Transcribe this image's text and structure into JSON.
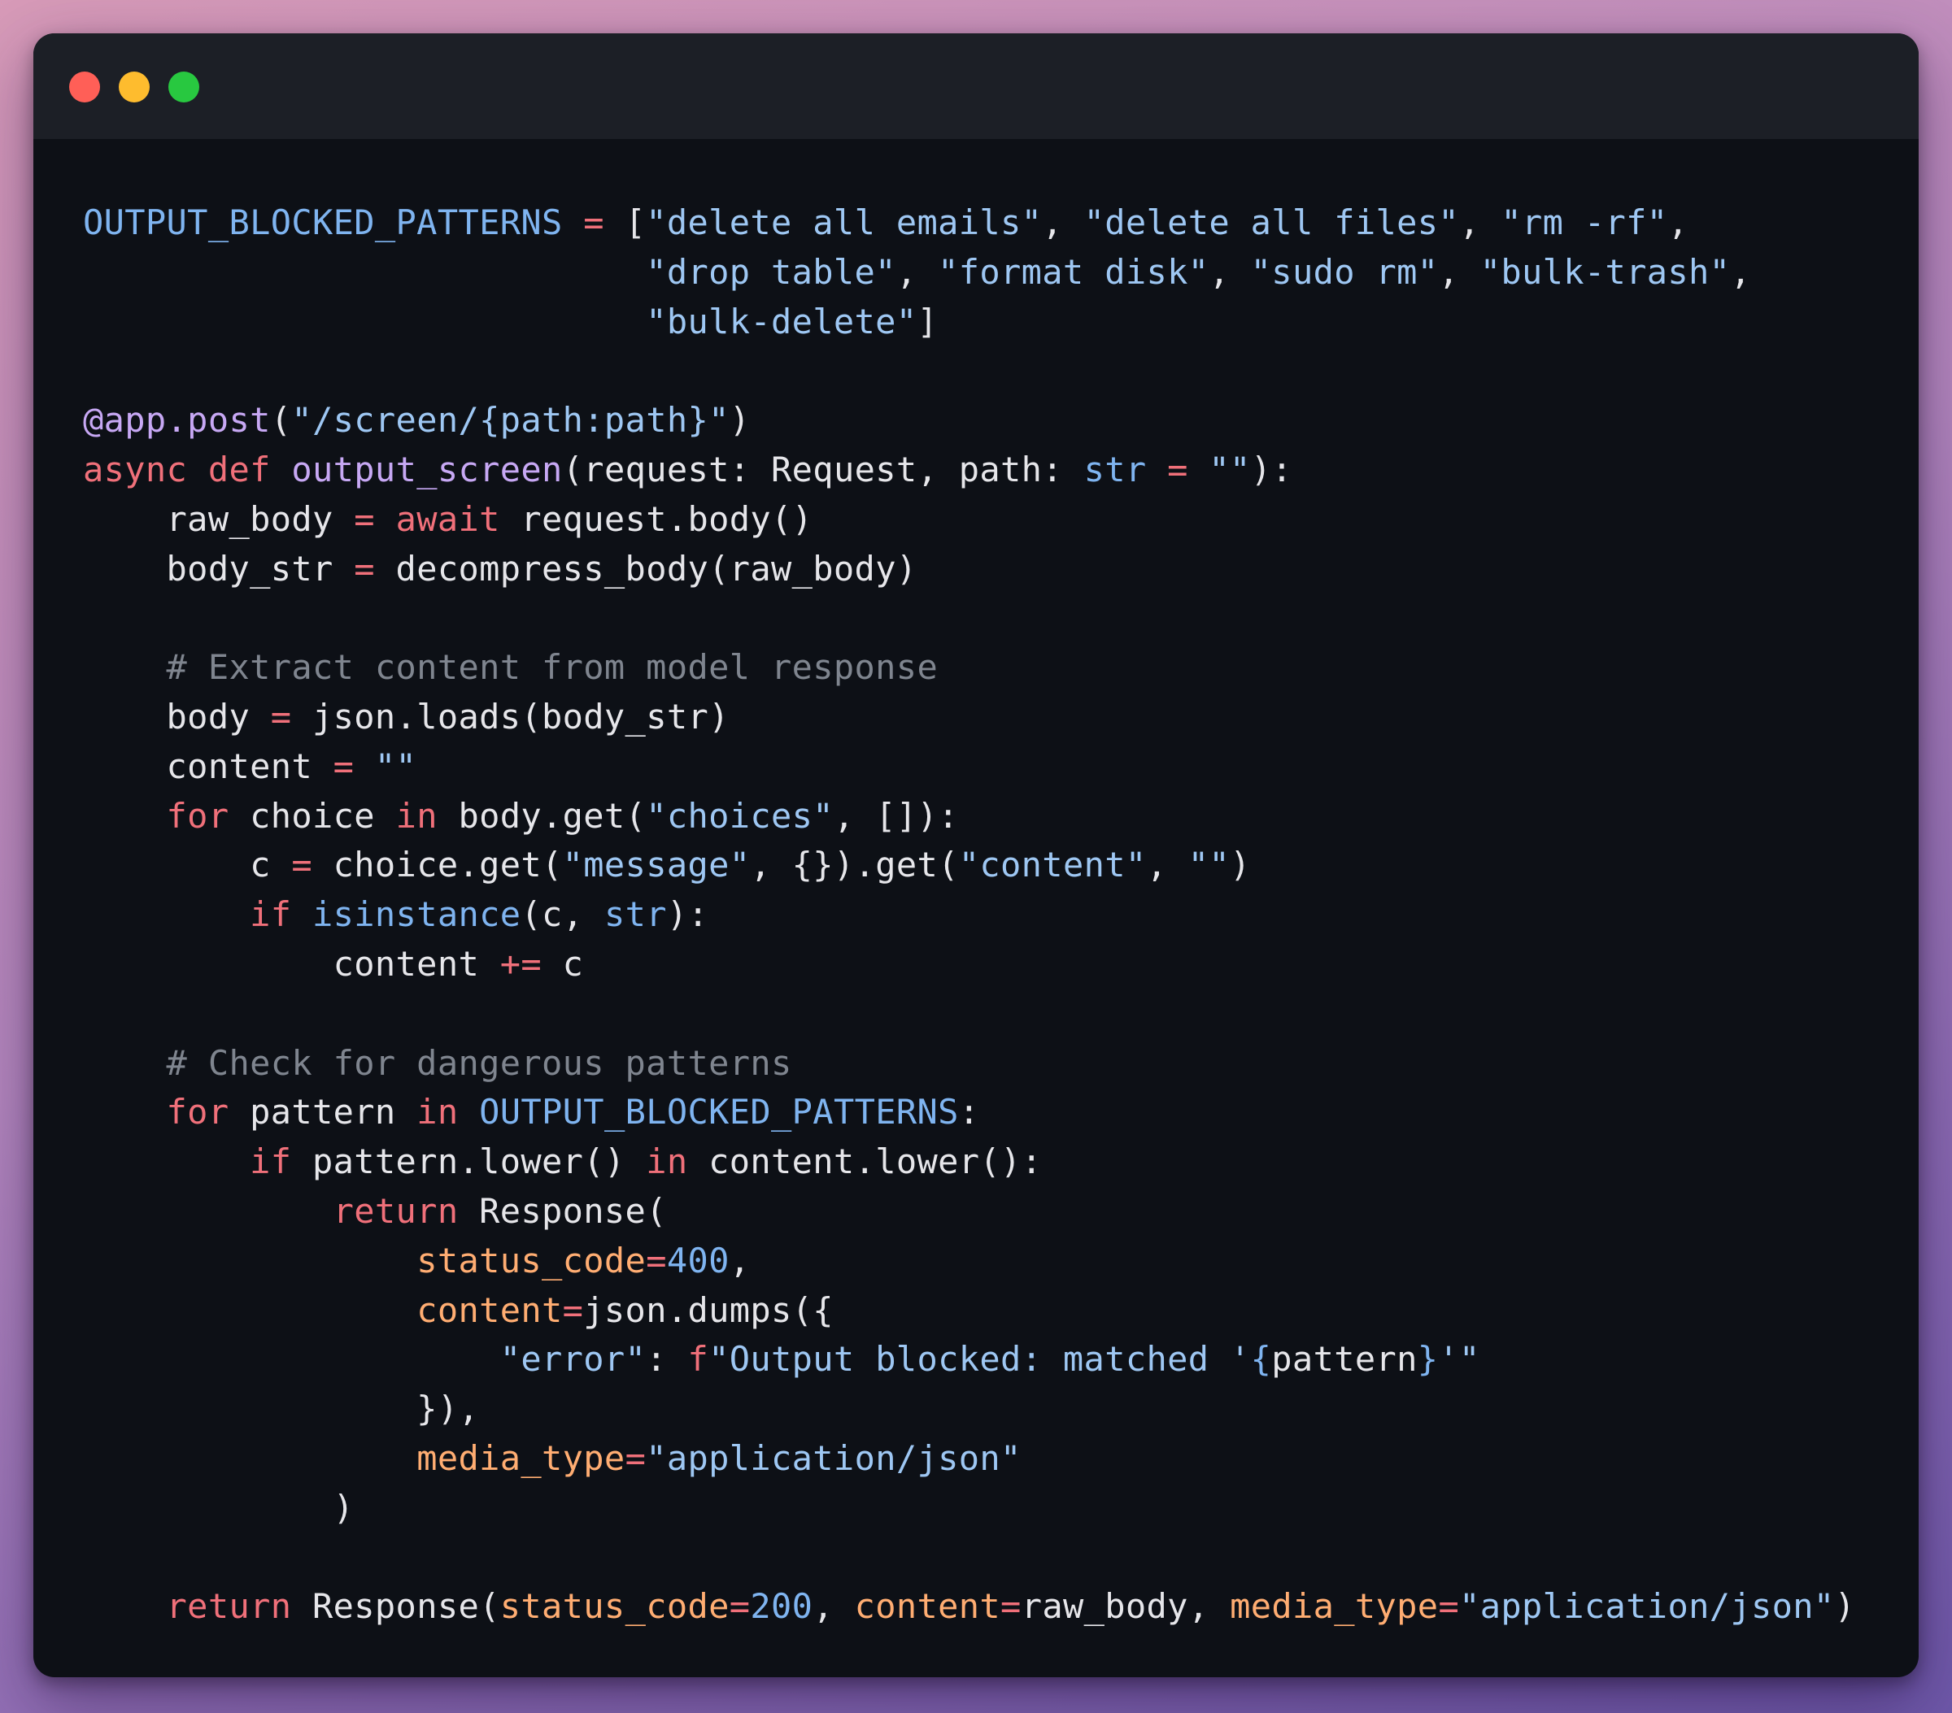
{
  "window": {
    "controls": [
      {
        "name": "close",
        "color": "#ff5f57"
      },
      {
        "name": "minimize",
        "color": "#febc2e"
      },
      {
        "name": "zoom",
        "color": "#28c840"
      }
    ]
  },
  "palette": {
    "keyword": "#f0707a",
    "string": "#9ec7f3",
    "function": "#c7a8f4",
    "constant": "#7fb4f0",
    "parameter": "#ffad72",
    "comment": "#7f858f",
    "text": "#e6e6ea",
    "background": "#0d1016",
    "titlebar": "#1c1f26"
  },
  "code_lines": [
    [
      [
        "cons",
        "OUTPUT_BLOCKED_PATTERNS"
      ],
      [
        "plain",
        " "
      ],
      [
        "op",
        "="
      ],
      [
        "plain",
        " ["
      ],
      [
        "str",
        "\"delete all emails\""
      ],
      [
        "plain",
        ", "
      ],
      [
        "str",
        "\"delete all files\""
      ],
      [
        "plain",
        ", "
      ],
      [
        "str",
        "\"rm -rf\""
      ],
      [
        "plain",
        ","
      ]
    ],
    [
      [
        "plain",
        "                           "
      ],
      [
        "str",
        "\"drop table\""
      ],
      [
        "plain",
        ", "
      ],
      [
        "str",
        "\"format disk\""
      ],
      [
        "plain",
        ", "
      ],
      [
        "str",
        "\"sudo rm\""
      ],
      [
        "plain",
        ", "
      ],
      [
        "str",
        "\"bulk-trash\""
      ],
      [
        "plain",
        ","
      ]
    ],
    [
      [
        "plain",
        "                           "
      ],
      [
        "str",
        "\"bulk-delete\""
      ],
      [
        "plain",
        "]"
      ]
    ],
    [],
    [
      [
        "dec",
        "@app.post"
      ],
      [
        "plain",
        "("
      ],
      [
        "str",
        "\"/screen/{path:path}\""
      ],
      [
        "plain",
        ")"
      ]
    ],
    [
      [
        "kw",
        "async"
      ],
      [
        "plain",
        " "
      ],
      [
        "kw",
        "def"
      ],
      [
        "plain",
        " "
      ],
      [
        "fn",
        "output_screen"
      ],
      [
        "plain",
        "(request: Request, path: "
      ],
      [
        "builtin",
        "str"
      ],
      [
        "plain",
        " "
      ],
      [
        "op",
        "="
      ],
      [
        "plain",
        " "
      ],
      [
        "str",
        "\"\""
      ],
      [
        "plain",
        "):"
      ]
    ],
    [
      [
        "plain",
        "    raw_body "
      ],
      [
        "op",
        "="
      ],
      [
        "plain",
        " "
      ],
      [
        "kw",
        "await"
      ],
      [
        "plain",
        " request.body()"
      ]
    ],
    [
      [
        "plain",
        "    body_str "
      ],
      [
        "op",
        "="
      ],
      [
        "plain",
        " decompress_body(raw_body)"
      ]
    ],
    [],
    [
      [
        "plain",
        "    "
      ],
      [
        "com",
        "# Extract content from model response"
      ]
    ],
    [
      [
        "plain",
        "    body "
      ],
      [
        "op",
        "="
      ],
      [
        "plain",
        " json.loads(body_str)"
      ]
    ],
    [
      [
        "plain",
        "    content "
      ],
      [
        "op",
        "="
      ],
      [
        "plain",
        " "
      ],
      [
        "str",
        "\"\""
      ]
    ],
    [
      [
        "plain",
        "    "
      ],
      [
        "kw",
        "for"
      ],
      [
        "plain",
        " choice "
      ],
      [
        "kw",
        "in"
      ],
      [
        "plain",
        " body.get("
      ],
      [
        "str",
        "\"choices\""
      ],
      [
        "plain",
        ", []):"
      ]
    ],
    [
      [
        "plain",
        "        c "
      ],
      [
        "op",
        "="
      ],
      [
        "plain",
        " choice.get("
      ],
      [
        "str",
        "\"message\""
      ],
      [
        "plain",
        ", {}).get("
      ],
      [
        "str",
        "\"content\""
      ],
      [
        "plain",
        ", "
      ],
      [
        "str",
        "\"\""
      ],
      [
        "plain",
        ")"
      ]
    ],
    [
      [
        "plain",
        "        "
      ],
      [
        "kw",
        "if"
      ],
      [
        "plain",
        " "
      ],
      [
        "builtin",
        "isinstance"
      ],
      [
        "plain",
        "(c, "
      ],
      [
        "builtin",
        "str"
      ],
      [
        "plain",
        "):"
      ]
    ],
    [
      [
        "plain",
        "            content "
      ],
      [
        "op",
        "+="
      ],
      [
        "plain",
        " c"
      ]
    ],
    [],
    [
      [
        "plain",
        "    "
      ],
      [
        "com",
        "# Check for dangerous patterns"
      ]
    ],
    [
      [
        "plain",
        "    "
      ],
      [
        "kw",
        "for"
      ],
      [
        "plain",
        " pattern "
      ],
      [
        "kw",
        "in"
      ],
      [
        "plain",
        " "
      ],
      [
        "cons",
        "OUTPUT_BLOCKED_PATTERNS"
      ],
      [
        "plain",
        ":"
      ]
    ],
    [
      [
        "plain",
        "        "
      ],
      [
        "kw",
        "if"
      ],
      [
        "plain",
        " pattern.lower() "
      ],
      [
        "kw",
        "in"
      ],
      [
        "plain",
        " content.lower():"
      ]
    ],
    [
      [
        "plain",
        "            "
      ],
      [
        "kw",
        "return"
      ],
      [
        "plain",
        " Response("
      ]
    ],
    [
      [
        "plain",
        "                "
      ],
      [
        "param",
        "status_code"
      ],
      [
        "op",
        "="
      ],
      [
        "num",
        "400"
      ],
      [
        "plain",
        ","
      ]
    ],
    [
      [
        "plain",
        "                "
      ],
      [
        "param",
        "content"
      ],
      [
        "op",
        "="
      ],
      [
        "plain",
        "json.dumps({"
      ]
    ],
    [
      [
        "plain",
        "                    "
      ],
      [
        "str",
        "\"error\""
      ],
      [
        "plain",
        ": "
      ],
      [
        "kw",
        "f"
      ],
      [
        "str",
        "\"Output blocked: matched '"
      ],
      [
        "cons",
        "{"
      ],
      [
        "plain",
        "pattern"
      ],
      [
        "cons",
        "}"
      ],
      [
        "str",
        "'\""
      ]
    ],
    [
      [
        "plain",
        "                }),"
      ]
    ],
    [
      [
        "plain",
        "                "
      ],
      [
        "param",
        "media_type"
      ],
      [
        "op",
        "="
      ],
      [
        "str",
        "\"application/json\""
      ]
    ],
    [
      [
        "plain",
        "            )"
      ]
    ],
    [],
    [
      [
        "plain",
        "    "
      ],
      [
        "kw",
        "return"
      ],
      [
        "plain",
        " Response("
      ],
      [
        "param",
        "status_code"
      ],
      [
        "op",
        "="
      ],
      [
        "num",
        "200"
      ],
      [
        "plain",
        ", "
      ],
      [
        "param",
        "content"
      ],
      [
        "op",
        "="
      ],
      [
        "plain",
        "raw_body, "
      ],
      [
        "param",
        "media_type"
      ],
      [
        "op",
        "="
      ],
      [
        "str",
        "\"application/json\""
      ],
      [
        "plain",
        ")"
      ]
    ]
  ]
}
